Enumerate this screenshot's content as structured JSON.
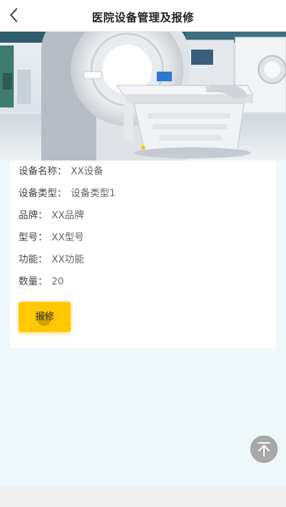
{
  "header": {
    "title": "医院设备管理及报修"
  },
  "banner": {
    "image_alt": "MRI scanner",
    "active_dot_color": "#ffc400"
  },
  "device": {
    "name_label": "设备名称：",
    "name_value": "XX设备",
    "type_label": "设备类型：",
    "type_value": "设备类型1",
    "brand_label": "品牌：",
    "brand_value": "XX品牌",
    "model_label": "型号：",
    "model_value": "XX型号",
    "function_label": "功能：",
    "function_value": "XX功能",
    "quantity_label": "数量：",
    "quantity_value": "20"
  },
  "actions": {
    "repair_label": "报修"
  },
  "icons": {
    "back": "chevron-left-icon",
    "to_top": "arrow-up-to-top-icon"
  },
  "colors": {
    "accent": "#ffc800",
    "page_bg": "#eef7f9"
  }
}
